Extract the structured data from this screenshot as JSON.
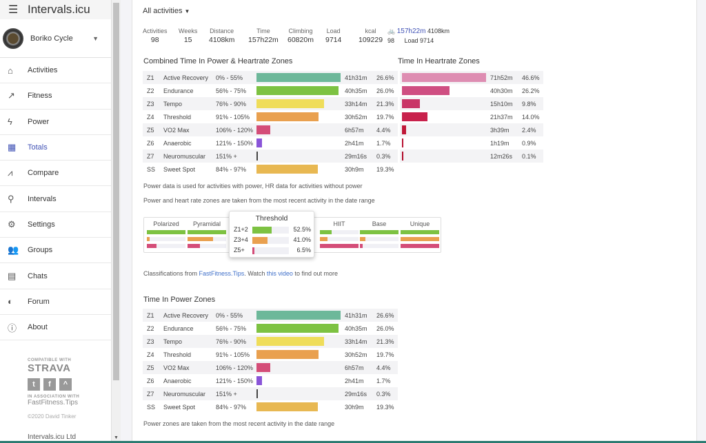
{
  "app": {
    "title": "Intervals.icu",
    "user": "Boriko Cycle"
  },
  "nav": [
    {
      "label": "Activities",
      "icon": "home-icon",
      "glyph": "⌂"
    },
    {
      "label": "Fitness",
      "icon": "trending-up-icon",
      "glyph": "↗"
    },
    {
      "label": "Power",
      "icon": "bolt-icon",
      "glyph": "ϟ"
    },
    {
      "label": "Totals",
      "icon": "calendar-clock-icon",
      "glyph": "▦",
      "active": true
    },
    {
      "label": "Compare",
      "icon": "compare-icon",
      "glyph": "⩘"
    },
    {
      "label": "Intervals",
      "icon": "search-icon",
      "glyph": "⚲"
    },
    {
      "label": "Settings",
      "icon": "gear-icon",
      "glyph": "⚙"
    },
    {
      "label": "Groups",
      "icon": "people-icon",
      "glyph": "👥"
    },
    {
      "label": "Chats",
      "icon": "chat-icon",
      "glyph": "▤"
    },
    {
      "label": "Forum",
      "icon": "discourse-icon",
      "glyph": "◐"
    },
    {
      "label": "About",
      "icon": "info-icon",
      "glyph": "ⓘ"
    }
  ],
  "footer": {
    "compatible": "COMPATIBLE WITH",
    "strava": "STRAVA",
    "assoc": "IN ASSOCIATION WITH",
    "ff": "FastFitness.Tips",
    "copy": "©2020 David Tinker",
    "ltd": "Intervals.icu Ltd"
  },
  "filter": "All activities",
  "stats": [
    {
      "label": "Activities",
      "value": "98"
    },
    {
      "label": "Weeks",
      "value": "15"
    },
    {
      "label": "Distance",
      "value": "4108km"
    },
    {
      "label": "Time",
      "value": "157h22m"
    },
    {
      "label": "Climbing",
      "value": "60820m"
    },
    {
      "label": "Load",
      "value": "9714"
    },
    {
      "label": "kcal",
      "value": "109229"
    }
  ],
  "bike": {
    "time": "157h22m",
    "distance": "4108km",
    "count": "98",
    "load": "Load 9714"
  },
  "combined_title": "Combined Time In Power & Heartrate Zones",
  "hr_title": "Time In Heartrate Zones",
  "power_title": "Time In Power Zones",
  "zones": [
    {
      "z": "Z1",
      "name": "Active Recovery",
      "range": "0% - 55%",
      "time": "41h31m",
      "pct": "26.6%",
      "v": 26.6,
      "color": "#6db89a"
    },
    {
      "z": "Z2",
      "name": "Endurance",
      "range": "56% - 75%",
      "time": "40h35m",
      "pct": "26.0%",
      "v": 26.0,
      "color": "#7dc242"
    },
    {
      "z": "Z3",
      "name": "Tempo",
      "range": "76% - 90%",
      "time": "33h14m",
      "pct": "21.3%",
      "v": 21.3,
      "color": "#efdd5a"
    },
    {
      "z": "Z4",
      "name": "Threshold",
      "range": "91% - 105%",
      "time": "30h52m",
      "pct": "19.7%",
      "v": 19.7,
      "color": "#e9a04f"
    },
    {
      "z": "Z5",
      "name": "VO2 Max",
      "range": "106% - 120%",
      "time": "6h57m",
      "pct": "4.4%",
      "v": 4.4,
      "color": "#d44d78"
    },
    {
      "z": "Z6",
      "name": "Anaerobic",
      "range": "121% - 150%",
      "time": "2h41m",
      "pct": "1.7%",
      "v": 1.7,
      "color": "#8a55d8"
    },
    {
      "z": "Z7",
      "name": "Neuromuscular",
      "range": "151% +",
      "time": "29m16s",
      "pct": "0.3%",
      "v": 0.3,
      "color": "#444444"
    },
    {
      "z": "SS",
      "name": "Sweet Spot",
      "range": "84% - 97%",
      "time": "30h9m",
      "pct": "19.3%",
      "v": 19.3,
      "color": "#e8b852"
    }
  ],
  "hr_zones": [
    {
      "time": "71h52m",
      "pct": "46.6%",
      "v": 46.6,
      "color": "#de8db2"
    },
    {
      "time": "40h30m",
      "pct": "26.2%",
      "v": 26.2,
      "color": "#cf4f82"
    },
    {
      "time": "15h10m",
      "pct": "9.8%",
      "v": 9.8,
      "color": "#c93567"
    },
    {
      "time": "21h37m",
      "pct": "14.0%",
      "v": 14.0,
      "color": "#c8214c"
    },
    {
      "time": "3h39m",
      "pct": "2.4%",
      "v": 2.4,
      "color": "#c01838"
    },
    {
      "time": "1h19m",
      "pct": "0.9%",
      "v": 0.9,
      "color": "#b81030"
    },
    {
      "time": "12m26s",
      "pct": "0.1%",
      "v": 0.1,
      "color": "#b00828"
    }
  ],
  "notes": {
    "n1": "Power data is used for activities with power, HR data for activities without power",
    "n2": "Power and heart rate zones are taken from the most recent activity in the date range",
    "cls_pre": "Classifications from ",
    "cls_link1": "FastFitness.Tips",
    "cls_mid": ". Watch ",
    "cls_link2": "this video",
    "cls_post": " to find out more",
    "n3": "Power zones are taken from the most recent activity in the date range"
  },
  "classifications": [
    {
      "name": "Polarized",
      "v": [
        100,
        8,
        25
      ]
    },
    {
      "name": "Pyramidal",
      "v": [
        100,
        66,
        33
      ]
    },
    {
      "name": "HIIT",
      "v": [
        30,
        20,
        100
      ]
    },
    {
      "name": "Base",
      "v": [
        100,
        15,
        8
      ]
    },
    {
      "name": "Unique",
      "v": [
        100,
        100,
        100
      ]
    }
  ],
  "popup": {
    "title": "Threshold",
    "rows": [
      {
        "label": "Z1+2",
        "pct": "52.5%",
        "v": 52.5,
        "color": "#7dc242"
      },
      {
        "label": "Z3+4",
        "pct": "41.0%",
        "v": 41.0,
        "color": "#e9a04f"
      },
      {
        "label": "Z5+",
        "pct": "6.5%",
        "v": 6.5,
        "color": "#d44d78"
      }
    ]
  }
}
